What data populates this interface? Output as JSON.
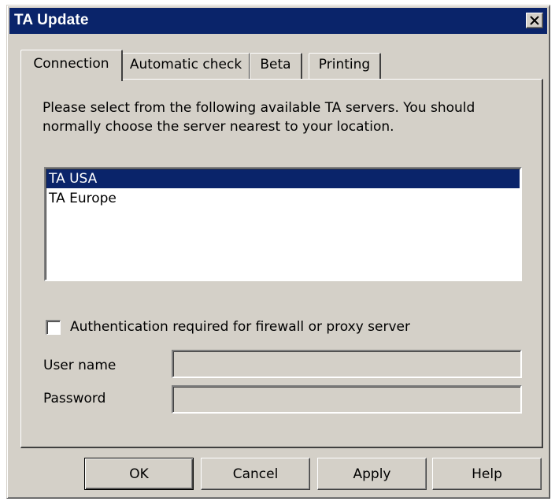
{
  "window": {
    "title": "TA Update",
    "close_symbol": "×"
  },
  "tabs": [
    {
      "label": "Connection",
      "selected": true
    },
    {
      "label": "Automatic check",
      "selected": false
    },
    {
      "label": "Beta",
      "selected": false
    },
    {
      "label": "Printing",
      "selected": false
    }
  ],
  "connection": {
    "description": "Please select from the following available TA servers. You should normally choose the server nearest to your location.",
    "servers": [
      {
        "label": "TA USA",
        "selected": true
      },
      {
        "label": "TA Europe",
        "selected": false
      }
    ],
    "auth_checkbox": {
      "label": "Authentication required for firewall or proxy server",
      "checked": false
    },
    "username": {
      "label": "User name",
      "value": ""
    },
    "password": {
      "label": "Password",
      "value": ""
    }
  },
  "buttons": {
    "ok": "OK",
    "cancel": "Cancel",
    "apply": "Apply",
    "help": "Help"
  },
  "colors": {
    "titlebar": "#0a246a",
    "face": "#d4d0c8",
    "selection": "#0a246a"
  }
}
